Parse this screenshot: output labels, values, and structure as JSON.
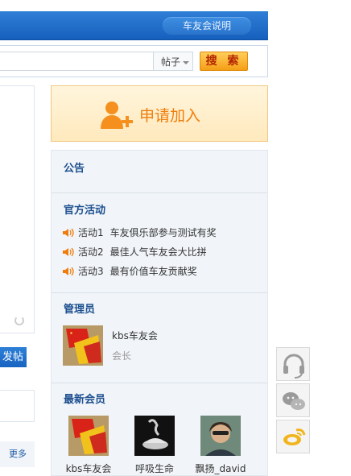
{
  "topbar": {
    "intro_button": "车友会说明"
  },
  "search": {
    "type_label": "帖子",
    "button_label": "搜 索",
    "input_value": ""
  },
  "left": {
    "post_button": "发帖",
    "more_link": "更多"
  },
  "join": {
    "label": "申请加入"
  },
  "notice": {
    "title": "公告"
  },
  "activities": {
    "title": "官方活动",
    "items": [
      {
        "num": "活动1",
        "text": "车友俱乐部参与测试有奖"
      },
      {
        "num": "活动2",
        "text": "最佳人气车友会大比拼"
      },
      {
        "num": "活动3",
        "text": "最有价值车友贡献奖"
      }
    ]
  },
  "admin": {
    "title": "管理员",
    "name": "kbs车友会",
    "role": "会长"
  },
  "members": {
    "title": "最新会员",
    "list": [
      {
        "name": "kbs车友会"
      },
      {
        "name": "呼吸生命"
      },
      {
        "name": "飘扬_david"
      }
    ]
  },
  "float_icons": [
    "headset-icon",
    "wechat-icon",
    "weibo-icon"
  ],
  "colors": {
    "brand_blue": "#1660bd",
    "join_orange": "#f07d0a",
    "section_blue": "#1d4f8f",
    "search_orange": "#f59f16"
  }
}
